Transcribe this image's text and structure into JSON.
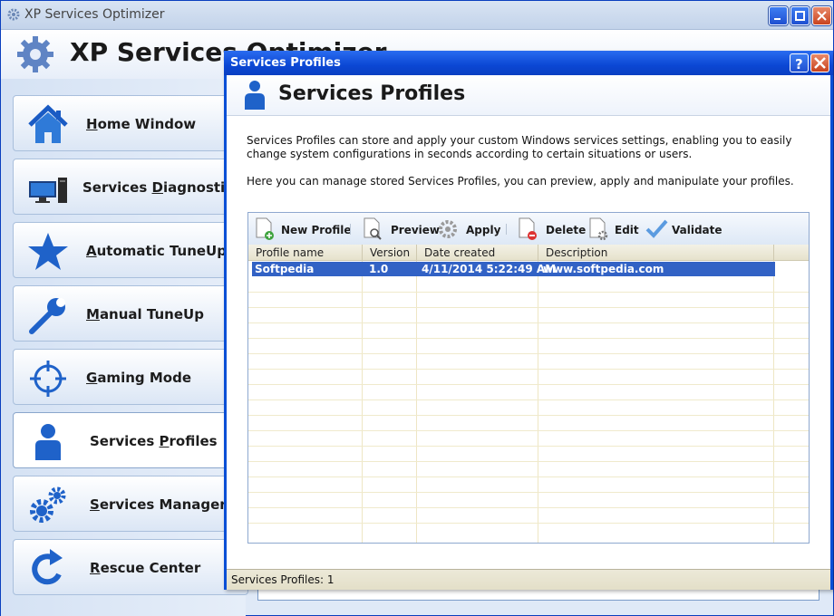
{
  "main_window": {
    "title": "XP Services Optimizer",
    "header_title": "XP Services Optimizer"
  },
  "sidebar": {
    "items": [
      {
        "label_pre": "",
        "label_key": "H",
        "label_post": "ome Window",
        "icon": "house-icon"
      },
      {
        "label_pre": "Services ",
        "label_key": "D",
        "label_post": "iagnostics",
        "icon": "computer-icon"
      },
      {
        "label_pre": "",
        "label_key": "A",
        "label_post": "utomatic TuneUp",
        "icon": "star-icon"
      },
      {
        "label_pre": "",
        "label_key": "M",
        "label_post": "anual TuneUp",
        "icon": "wrench-icon"
      },
      {
        "label_pre": "",
        "label_key": "G",
        "label_post": "aming Mode",
        "icon": "crosshair-icon"
      },
      {
        "label_pre": "Services ",
        "label_key": "P",
        "label_post": "rofiles",
        "icon": "user-icon"
      },
      {
        "label_pre": "",
        "label_key": "S",
        "label_post": "ervices Manager",
        "icon": "gears-icon"
      },
      {
        "label_pre": "",
        "label_key": "R",
        "label_post": "escue Center",
        "icon": "refresh-icon"
      }
    ]
  },
  "dialog": {
    "title": "Services Profiles",
    "heading": "Services Profiles",
    "description_1": "Services Profiles can store and apply your custom Windows services settings, enabling you to easily change system configurations in seconds according to certain situations or users.",
    "description_2": "Here you can manage stored Services Profiles, you can preview, apply and manipulate your profiles.",
    "toolbar": {
      "new_profile": "New Profile",
      "preview": "Preview",
      "apply": "Apply",
      "delete": "Delete",
      "edit": "Edit",
      "validate": "Validate"
    },
    "columns": [
      "Profile name",
      "Version",
      "Date created",
      "Description"
    ],
    "rows": [
      {
        "name": "Softpedia",
        "version": "1.0",
        "date": "4/11/2014 5:22:49 AM",
        "description": "www.softpedia.com"
      }
    ],
    "status": "Services Profiles: 1"
  },
  "colors": {
    "accent": "#0b47d4",
    "selection": "#3262c5"
  }
}
